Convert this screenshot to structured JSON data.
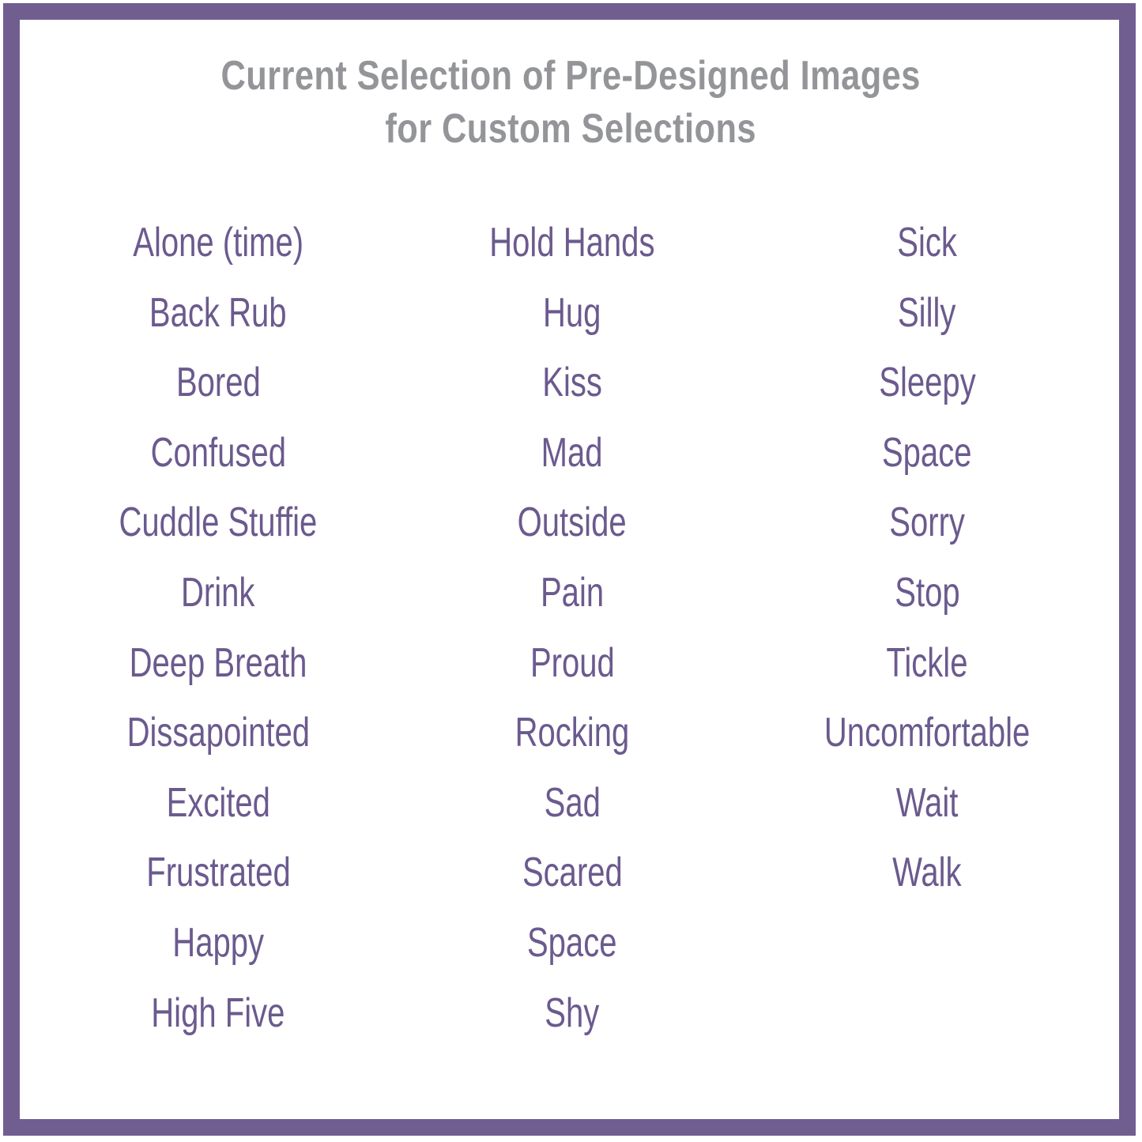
{
  "colors": {
    "border": "#705e91",
    "title": "#939598",
    "item": "#6b5a8e",
    "background": "#ffffff"
  },
  "title": {
    "line1": "Current Selection of Pre-Designed Images",
    "line2": "for Custom Selections"
  },
  "columns": [
    {
      "items": [
        "Alone (time)",
        "Back Rub",
        "Bored",
        "Confused",
        "Cuddle Stuffie",
        "Drink",
        "Deep Breath",
        "Dissapointed",
        "Excited",
        "Frustrated",
        "Happy",
        "High Five"
      ]
    },
    {
      "items": [
        "Hold Hands",
        "Hug",
        "Kiss",
        "Mad",
        "Outside",
        "Pain",
        "Proud",
        "Rocking",
        "Sad",
        "Scared",
        "Space",
        "Shy"
      ]
    },
    {
      "items": [
        "Sick",
        "Silly",
        "Sleepy",
        "Space",
        "Sorry",
        "Stop",
        "Tickle",
        "Uncomfortable",
        "Wait",
        "Walk"
      ]
    }
  ]
}
